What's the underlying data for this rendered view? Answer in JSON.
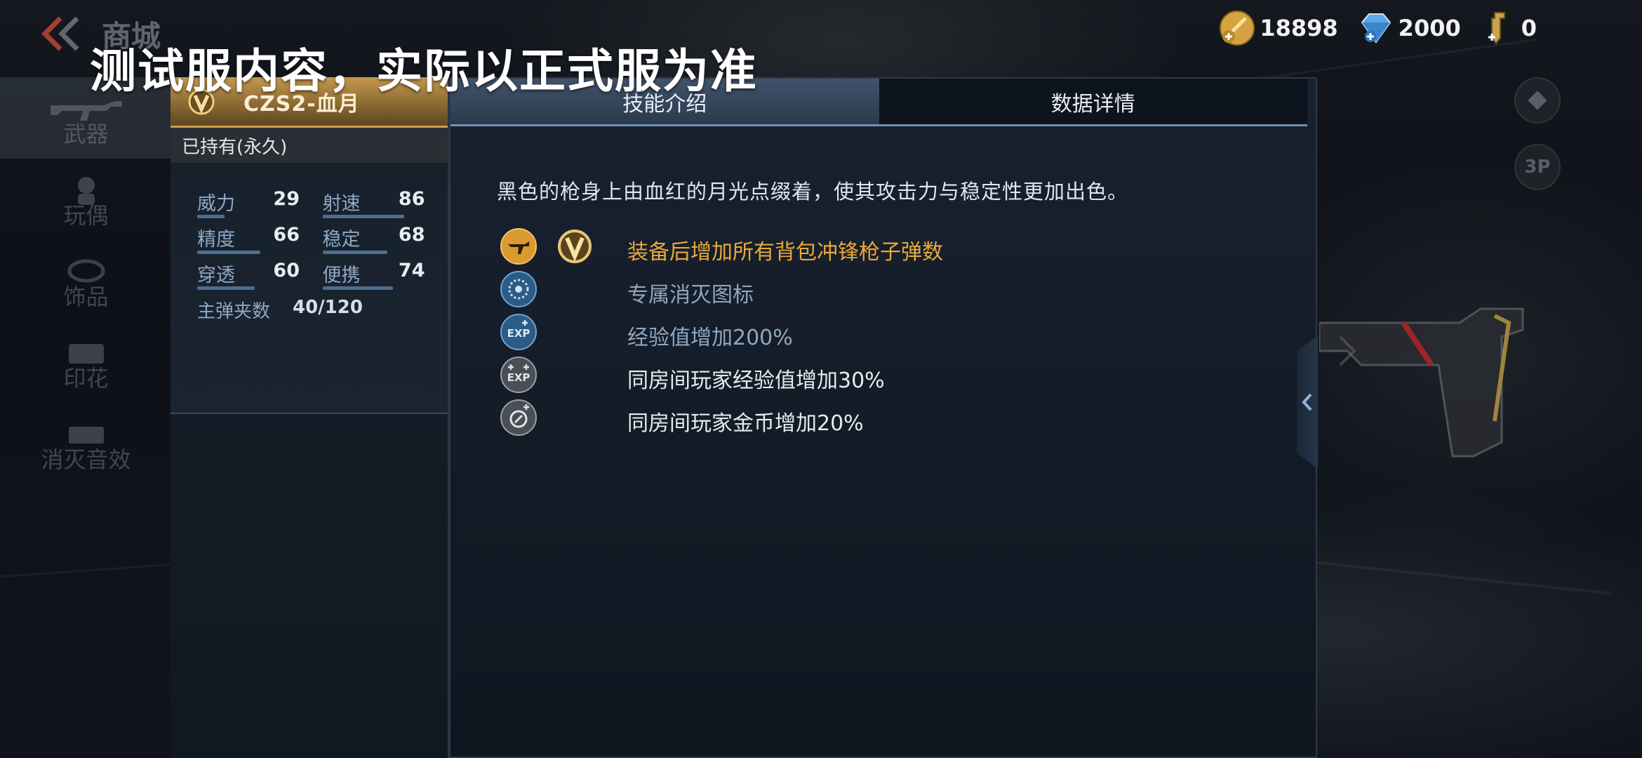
{
  "header": {
    "title": "商城",
    "watermark": "测试服内容，实际以正式服为准"
  },
  "currency": [
    {
      "name": "gold-coin",
      "value": "18898"
    },
    {
      "name": "diamond",
      "value": "2000"
    },
    {
      "name": "key",
      "value": "0"
    }
  ],
  "sidebar": {
    "items": [
      {
        "label": "武器",
        "active": true
      },
      {
        "label": "玩偶",
        "active": false
      },
      {
        "label": "饰品",
        "active": false
      },
      {
        "label": "印花",
        "active": false
      },
      {
        "label": "消灭音效",
        "active": false
      }
    ]
  },
  "side_buttons": {
    "view_3p": "3P"
  },
  "item": {
    "name": "CZS2-血月",
    "ownership": "已持有(永久)",
    "stats": [
      {
        "label": "威力",
        "value": "29",
        "level": 0.29
      },
      {
        "label": "射速",
        "value": "86",
        "level": 0.86
      },
      {
        "label": "精度",
        "value": "66",
        "level": 0.66
      },
      {
        "label": "稳定",
        "value": "68",
        "level": 0.68
      },
      {
        "label": "穿透",
        "value": "60",
        "level": 0.6
      },
      {
        "label": "便携",
        "value": "74",
        "level": 0.74
      }
    ],
    "ammo_label": "主弹夹数",
    "ammo_value": "40/120"
  },
  "tabs": [
    {
      "label": "技能介绍",
      "active": true
    },
    {
      "label": "数据详情",
      "active": false
    }
  ],
  "skill_panel": {
    "description": "黑色的枪身上由血红的月光点缀着，使其攻击力与稳定性更加出色。",
    "skills": [
      {
        "text": "装备后增加所有背包冲锋枪子弹数",
        "color": "#e9a93a",
        "icon": "smg-icon",
        "badge": "v-rank-badge"
      },
      {
        "text": "专属消灭图标",
        "color": "#8fa6bf",
        "icon": "kill-mark-icon"
      },
      {
        "text": "经验值增加200%",
        "color": "#8fa6bf",
        "icon": "exp-icon"
      },
      {
        "text": "同房间玩家经验值增加30%",
        "color": "#e6ebf0",
        "icon": "room-exp-icon"
      },
      {
        "text": "同房间玩家金币增加20%",
        "color": "#e6ebf0",
        "icon": "room-gold-icon"
      }
    ]
  },
  "colors": {
    "accent_gold": "#d2a04a",
    "tab_underline": "#6f90b7",
    "stat_bar": "#4d6d92"
  }
}
